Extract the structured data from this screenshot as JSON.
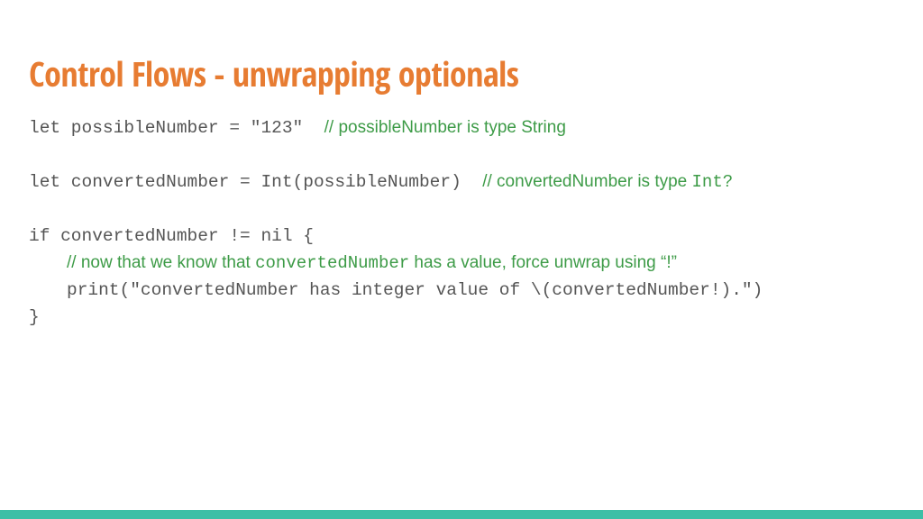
{
  "title": "Control Flows - unwrapping optionals",
  "lines": {
    "l1_code": "let possibleNumber = \"123\"  ",
    "l1_comment": "// possibleNumber is type String",
    "l2_code": "let convertedNumber = Int(possibleNumber)  ",
    "l2_comment_a": "// convertedNumber is type ",
    "l2_comment_b": "Int?",
    "l3_code": "if convertedNumber != nil {",
    "l4_comment_a": "// now that we know that ",
    "l4_comment_b": "convertedNumber",
    "l4_comment_c": " has a value, force unwrap using ",
    "l4_comment_d": "“!”",
    "l5_code": "print(\"convertedNumber has integer value of \\(convertedNumber!).\")",
    "l6_code": "}"
  }
}
